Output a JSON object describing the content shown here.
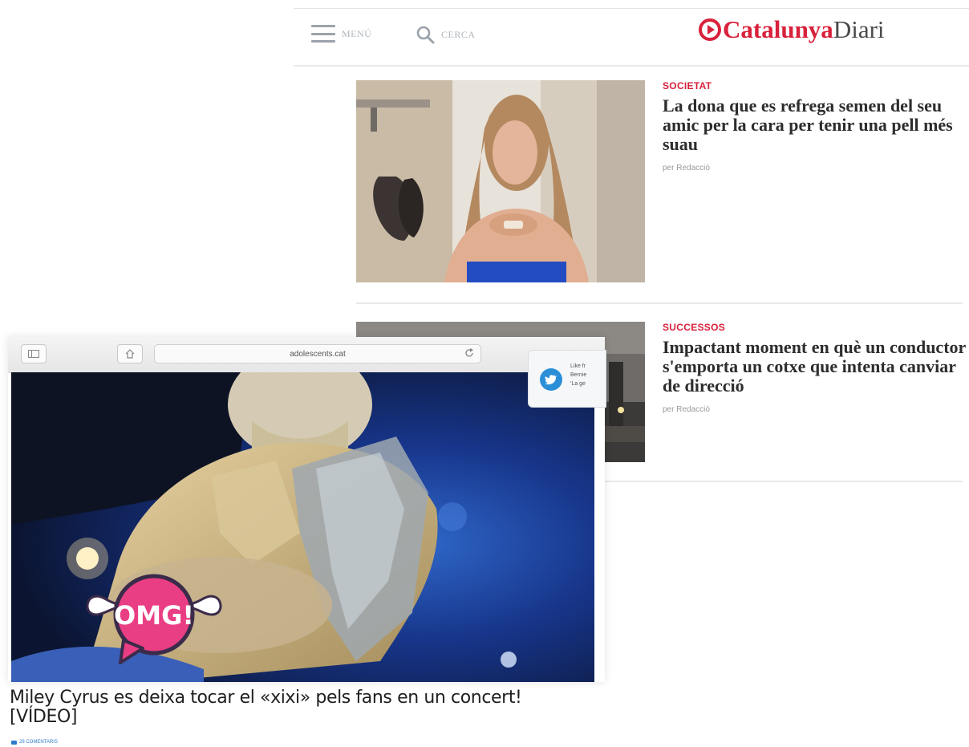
{
  "site": {
    "menu_label": "MENÚ",
    "search_label": "CERCA",
    "logo_primary": "Catalunya",
    "logo_secondary": "Diari",
    "brand_color": "#d8213b"
  },
  "articles": [
    {
      "category": "SOCIETAT",
      "headline": "La dona que es refrega semen del seu amic per la cara per tenir una pell més suau",
      "byline": "per Redacció"
    },
    {
      "category": "SUCCESSOS",
      "headline": "Impactant moment en què un conductor s'emporta un cotxe que intenta canviar de direcció",
      "byline": "per Redacció"
    }
  ],
  "browser": {
    "url": "adolescents.cat",
    "notification": {
      "line1": "Like fr",
      "line2": "Bernie",
      "line3": "'La ge",
      "icon": "twitter-bird-icon"
    },
    "badge_text": "OMG!",
    "title": "Miley Cyrus es deixa tocar el «xixi» pels fans en un concert! [VÍDEO]",
    "comments": "28 COMENTARIS"
  }
}
